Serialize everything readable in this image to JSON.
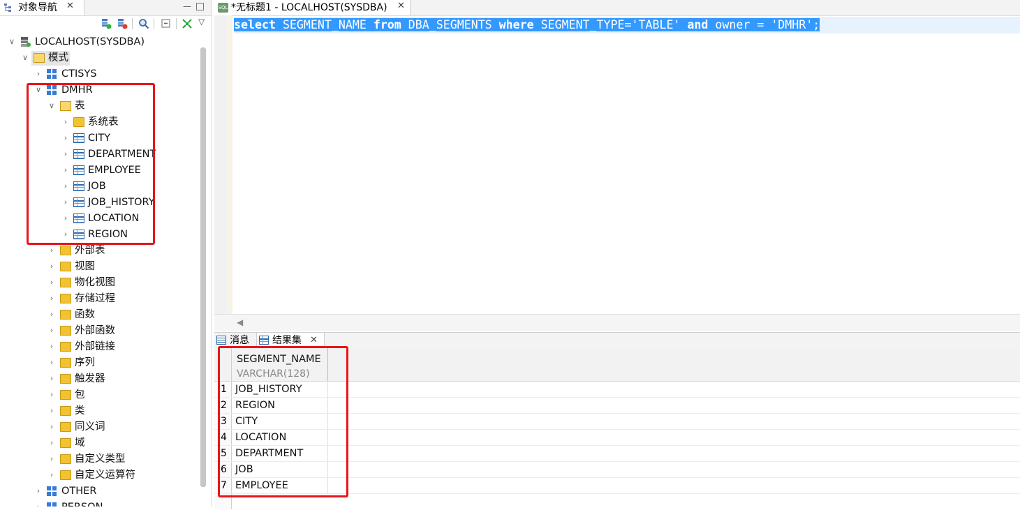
{
  "navigator": {
    "tab_title": "对象导航",
    "tree": {
      "connection": "LOCALHOST(SYSDBA)",
      "schemas_folder": "模式",
      "schema_ctisys": "CTISYS",
      "schema_dmhr": "DMHR",
      "tables_folder": "表",
      "system_tables": "系统表",
      "tables": [
        "CITY",
        "DEPARTMENT",
        "EMPLOYEE",
        "JOB",
        "JOB_HISTORY",
        "LOCATION",
        "REGION"
      ],
      "folders": [
        "外部表",
        "视图",
        "物化视图",
        "存储过程",
        "函数",
        "外部函数",
        "外部链接",
        "序列",
        "触发器",
        "包",
        "类",
        "同义词",
        "域",
        "自定义类型",
        "自定义运算符"
      ],
      "schema_other": "OTHER",
      "schema_person": "PERSON"
    }
  },
  "editor": {
    "tab_title": "*无标题1 - LOCALHOST(SYSDBA)",
    "tab_icon_text": "SQL",
    "sql": {
      "k1": "select",
      "t1": " SEGMENT_NAME ",
      "k2": "from",
      "t2": " DBA_SEGMENTS ",
      "k3": "where",
      "t3": " SEGMENT_TYPE='TABLE' ",
      "k4": "and",
      "t4": " owner = 'DMHR';"
    }
  },
  "results": {
    "tab_messages": "消息",
    "tab_resultset": "结果集",
    "column": {
      "name": "SEGMENT_NAME",
      "type": "VARCHAR(128)"
    },
    "rows": [
      {
        "num": "1",
        "value": "JOB_HISTORY"
      },
      {
        "num": "2",
        "value": "REGION"
      },
      {
        "num": "3",
        "value": "CITY"
      },
      {
        "num": "4",
        "value": "LOCATION"
      },
      {
        "num": "5",
        "value": "DEPARTMENT"
      },
      {
        "num": "6",
        "value": "JOB"
      },
      {
        "num": "7",
        "value": "EMPLOYEE"
      }
    ]
  },
  "colors": {
    "selection": "#3399ff",
    "annotation": "#e8141c",
    "folder": "#f2c233"
  },
  "icons": {
    "navigator_tab": "tree-icon",
    "connect": "connect-icon",
    "disconnect": "disconnect-icon",
    "search": "search-icon",
    "collapse": "collapse-icon",
    "link": "link-icon",
    "menu": "view-menu-icon"
  }
}
